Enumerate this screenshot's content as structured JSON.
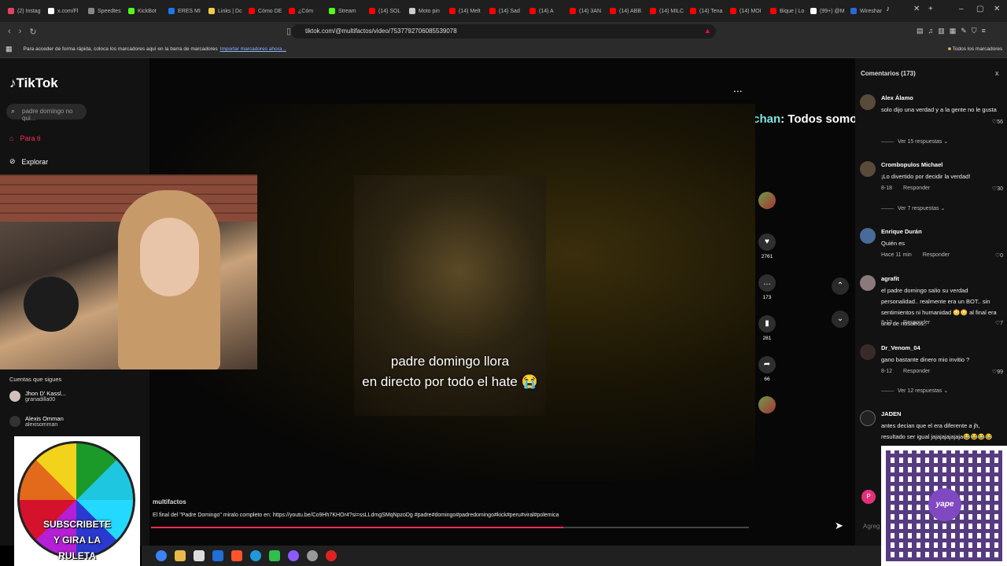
{
  "browser": {
    "tabs": [
      "(2) Instag",
      "x.com/Fl",
      "Speedtes",
      "KickBot",
      "ERES MI",
      "Links | Dc",
      "Cómo DE",
      "¿Cóm",
      "Stream",
      "(14) SOL",
      "Moto pin",
      "(14) Melt",
      "(14) Sad",
      "(14) A",
      "(14) 3AN",
      "(14) ABB",
      "(14) MILC",
      "(14) Tena",
      "(14) MOI",
      "Bique | Lo",
      "(99+) @M",
      "Wireshar"
    ],
    "active_tab": "",
    "url": "tiktok.com/@multifactos/video/7537792706085539078",
    "bookmarks_text": "Para acceder de forma rápida, coloca los marcadores aquí en la barra de marcadores",
    "bookmarks_link": "Importar marcadores ahora...",
    "all_bookmarks": "Todos los marcadores"
  },
  "sidebar": {
    "logo": "TikTok",
    "search_placeholder": "padre domingo no qui...",
    "nav": [
      {
        "label": "Para ti"
      },
      {
        "label": "Explorar"
      }
    ],
    "following_title": "Cuentas que sigues",
    "following": [
      {
        "name": "Jhon D' Kassl...",
        "handle": "granadilla00"
      },
      {
        "name": "Alexis Omman",
        "handle": "alexisomman"
      }
    ]
  },
  "video": {
    "more_label": "...",
    "chat_user": "fandomoniichan",
    "chat_msg": ": Todos somos pecadores",
    "caption_line1": "padre domingo llora",
    "caption_line2": "en directo por todo el hate 😭",
    "author": "multifactos",
    "description": "El final del \"Padre Domingo\" miralo completo en: https://youtu.be/Co9Hh7KHOr4?si=ssLLdmgSMqNpzoDg  #padre#domingo#padredomingo#kick#peru#viral#polemica",
    "progress": 0.69,
    "likes": "2761",
    "comments_count": "173",
    "saves": "281",
    "shares": "66"
  },
  "comments": {
    "title": "Comentarios (173)",
    "close": "x",
    "items": [
      {
        "name": "Alex Álamo",
        "text": "solo dijo una verdad y a la gente no le gusta",
        "likes": "56",
        "replies": "Ver 15 respuestas"
      },
      {
        "name": "Crombopulos Michael",
        "text": "¡Lo divertido por decidir la verdad!",
        "date": "8-18",
        "reply": "Responder",
        "likes": "30",
        "replies": "Ver 7 respuestas"
      },
      {
        "name": "Enrique Durán",
        "text": "Quién es",
        "date": "Hace 11 min",
        "reply": "Responder",
        "likes": "0"
      },
      {
        "name": "agrafit",
        "text": "el padre domingo salio su verdad personalidad.. realmente era un BOT.. sin sentimientos ni humanidad 😳😳 al final era uno de nosotros..",
        "date": "8-13",
        "reply": "Responder",
        "likes": "7"
      },
      {
        "name": "Dr_Venom_04",
        "text": "gano bastante dinero mio invitio ?",
        "date": "8-12",
        "reply": "Responder",
        "likes": "99",
        "replies": "Ver 12 respuestas"
      },
      {
        "name": "JADEN",
        "text": "antes decian que el era diferente a jh, resultado ser igual jajajajajajaja😂😂😂😂"
      }
    ],
    "add_placeholder": "Agreg"
  },
  "overlay": {
    "wheel_text_1": "SUBSCRIBETE",
    "wheel_text_2": "Y GIRA LA",
    "wheel_text_3": "RULETA",
    "qr_logo": "yape"
  },
  "colors": {
    "accent": "#fe2c55",
    "chat_name": "#7ee6e0"
  }
}
